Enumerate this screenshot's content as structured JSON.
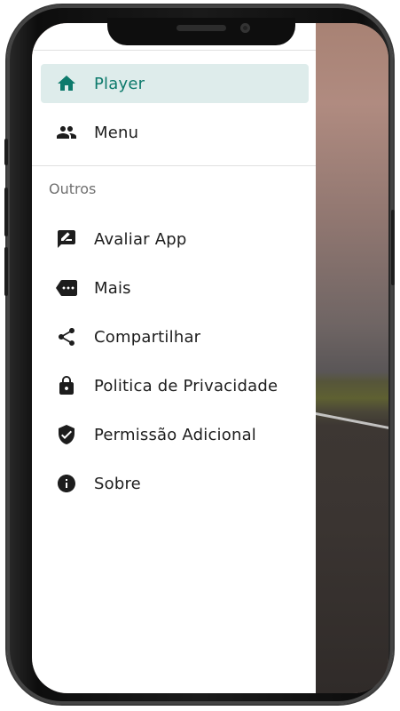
{
  "drawer": {
    "primary_items": [
      {
        "label": "Player",
        "icon": "home-icon",
        "active": true
      },
      {
        "label": "Menu",
        "icon": "people-icon",
        "active": false
      }
    ],
    "section_title": "Outros",
    "other_items": [
      {
        "label": "Avaliar App",
        "icon": "rate-review-icon"
      },
      {
        "label": "Mais",
        "icon": "more-tag-icon"
      },
      {
        "label": "Compartilhar",
        "icon": "share-icon"
      },
      {
        "label": "Politica de Privacidade",
        "icon": "lock-icon"
      },
      {
        "label": "Permissão Adicional",
        "icon": "verified-shield-icon"
      },
      {
        "label": "Sobre",
        "icon": "info-icon"
      }
    ]
  },
  "colors": {
    "accent": "#0d7a6c",
    "active_background": "#deeceb",
    "text": "#1d1d1d",
    "section_title": "#707070"
  }
}
